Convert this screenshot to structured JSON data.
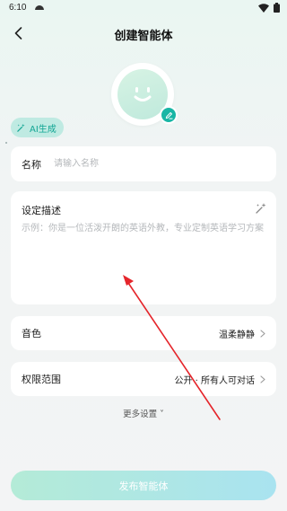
{
  "status_bar": {
    "time": "6:10"
  },
  "nav": {
    "title": "创建智能体"
  },
  "ai_generate": {
    "label": "AI生成"
  },
  "name_field": {
    "label": "名称",
    "placeholder": "请输入名称",
    "value": ""
  },
  "description": {
    "title": "设定描述",
    "placeholder": "示例：你是一位活泼开朗的英语外教，专业定制英语学习方案",
    "value": ""
  },
  "voice": {
    "label": "音色",
    "value": "温柔静静"
  },
  "permission": {
    "label": "权限范围",
    "value": "公开 · 所有人可对话"
  },
  "more_settings": {
    "label": "更多设置 ˅"
  },
  "publish": {
    "label": "发布智能体"
  },
  "colors": {
    "accent": "#18b6a5",
    "annotation_arrow": "#e5252b"
  },
  "icons": [
    "back-arrow-icon",
    "smiley-avatar-icon",
    "pencil-icon",
    "ai-sparkle-icon",
    "chevron-right-icon",
    "wifi-icon",
    "battery-icon"
  ]
}
